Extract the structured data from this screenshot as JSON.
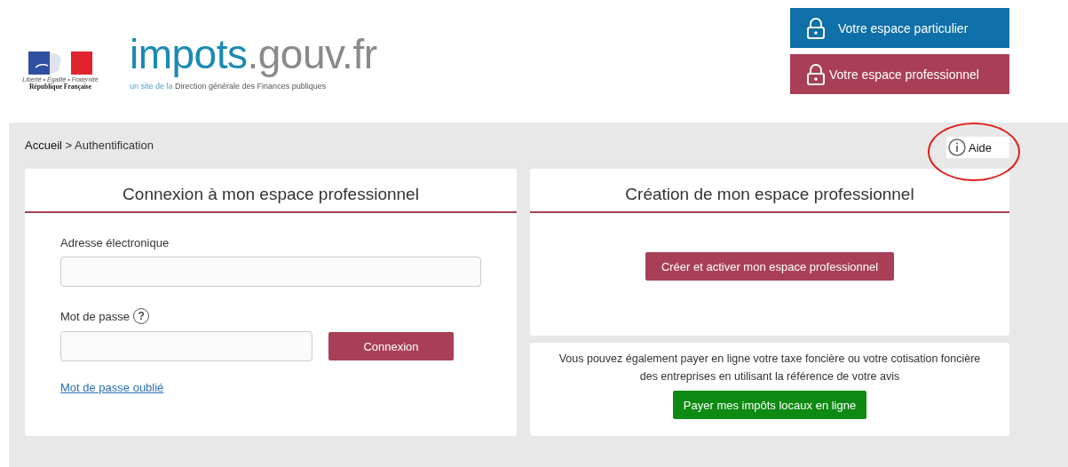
{
  "header": {
    "emblem": {
      "motto": "Liberté • Égalité • Fraternité",
      "name": "République Française"
    },
    "site_title": {
      "main": "impots",
      "domain": ".gouv.fr"
    },
    "tagline": {
      "prefix": "un site de la",
      "rest": "Direction générale des Finances publiques"
    },
    "space_buttons": [
      {
        "label": "Votre espace particulier",
        "color": "#0f6fa8"
      },
      {
        "label": "Votre espace professionnel",
        "color": "#a83f56"
      }
    ]
  },
  "breadcrumb": {
    "home": "Accueil",
    "separator": ">",
    "current": "Authentification"
  },
  "help": {
    "label": "Aide",
    "highlighted": true
  },
  "login_card": {
    "title": "Connexion à mon espace professionnel",
    "email_label": "Adresse électronique",
    "password_label": "Mot de passe",
    "help_icon": "?",
    "submit": "Connexion",
    "forgot_link": "Mot de passe oublié"
  },
  "create_card": {
    "title": "Création de mon espace professionnel",
    "button": "Créer et activer mon espace professionnel"
  },
  "payment_card": {
    "text": "Vous pouvez également payer en ligne votre taxe foncière ou votre cotisation foncière des entreprises en utilisant la référence de votre avis",
    "button": "Payer mes impôts locaux en ligne"
  }
}
